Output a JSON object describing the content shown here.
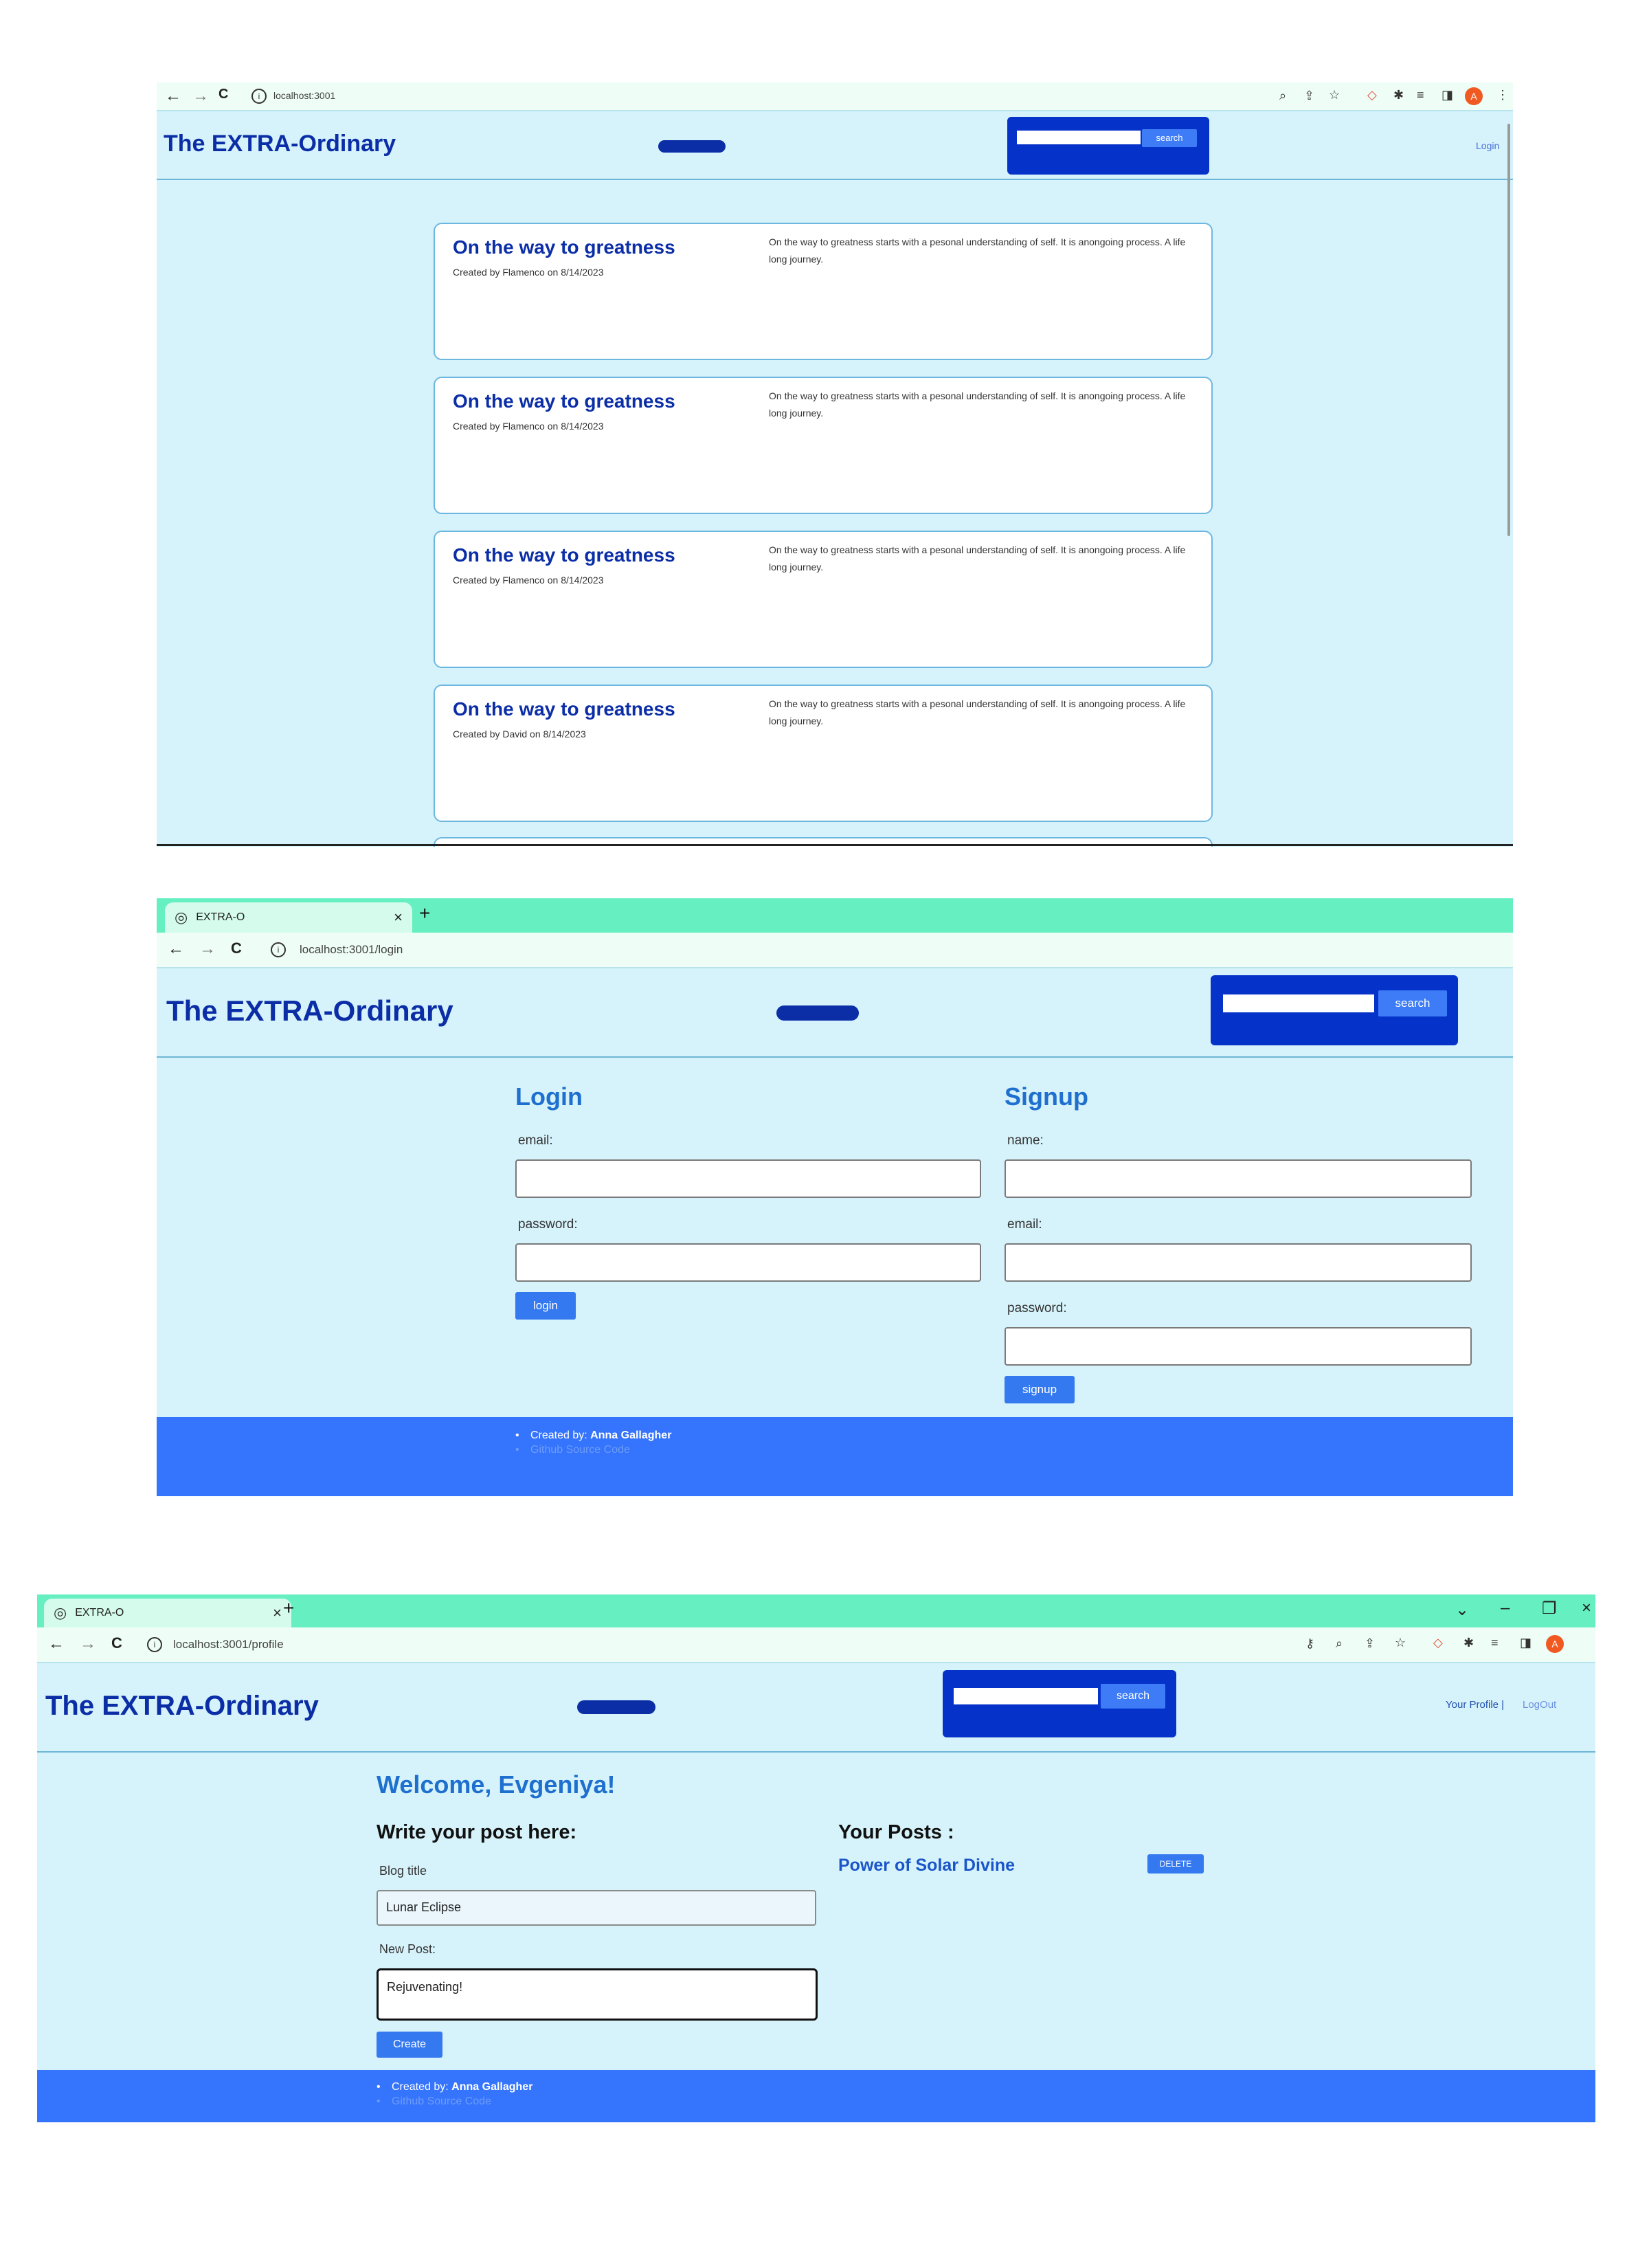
{
  "screen1": {
    "browser": {
      "url": "localhost:3001"
    },
    "header": {
      "brand": "The EXTRA-Ordinary",
      "search_button": "search",
      "nav_login": "Login"
    },
    "posts": [
      {
        "title": "On the way to greatness",
        "meta": "Created by Flamenco on 8/14/2023",
        "body": "On the way to greatness starts with a pesonal understanding of self. It is anongoing process. A life long journey."
      },
      {
        "title": "On the way to greatness",
        "meta": "Created by Flamenco on 8/14/2023",
        "body": "On the way to greatness starts with a pesonal understanding of self. It is anongoing process. A life long journey."
      },
      {
        "title": "On the way to greatness",
        "meta": "Created by Flamenco on 8/14/2023",
        "body": "On the way to greatness starts with a pesonal understanding of self. It is anongoing process. A life long journey."
      },
      {
        "title": "On the way to greatness",
        "meta": "Created by David on 8/14/2023",
        "body": "On the way to greatness starts with a pesonal understanding of self. It is anongoing process. A life long journey."
      }
    ]
  },
  "screen2": {
    "browser": {
      "tab_title": "EXTRA-O",
      "url": "localhost:3001/login"
    },
    "header": {
      "brand": "The EXTRA-Ordinary",
      "search_button": "search"
    },
    "login": {
      "heading": "Login",
      "email_label": "email:",
      "password_label": "password:",
      "button": "login"
    },
    "signup": {
      "heading": "Signup",
      "name_label": "name:",
      "email_label": "email:",
      "password_label": "password:",
      "button": "signup"
    },
    "footer": {
      "created_prefix": "Created by:",
      "author": "Anna Gallagher",
      "source_link": "Github Source Code"
    }
  },
  "screen3": {
    "browser": {
      "tab_title": "EXTRA-O",
      "url": "localhost:3001/profile"
    },
    "header": {
      "brand": "The EXTRA-Ordinary",
      "search_button": "search",
      "nav_profile": "Your Profile |",
      "nav_logout": "LogOut"
    },
    "welcome": "Welcome, Evgeniya!",
    "compose": {
      "heading": "Write your post here:",
      "title_label": "Blog title",
      "title_value": "Lunar Eclipse",
      "post_label": "New Post:",
      "post_value": "Rejuvenating!",
      "button": "Create"
    },
    "your_posts": {
      "heading": "Your Posts :",
      "items": [
        {
          "title": "Power of Solar Divine",
          "delete_label": "DELETE"
        }
      ]
    },
    "footer": {
      "created_prefix": "Created by:",
      "author": "Anna Gallagher",
      "source_link": "Github Source Code"
    }
  },
  "icons": {
    "back": "arrow-left-icon",
    "forward": "arrow-right-icon",
    "reload": "reload-icon",
    "site_info": "info-icon",
    "tab_site": "globe-icon",
    "close": "close-icon",
    "new_tab": "plus-icon"
  },
  "colors": {
    "page_bg": "#d6f3fb",
    "brand": "#0b2ea7",
    "search_box": "#0532c8",
    "button": "#3579f0",
    "footer": "#3574fd",
    "tabbar": "#66efc1"
  }
}
